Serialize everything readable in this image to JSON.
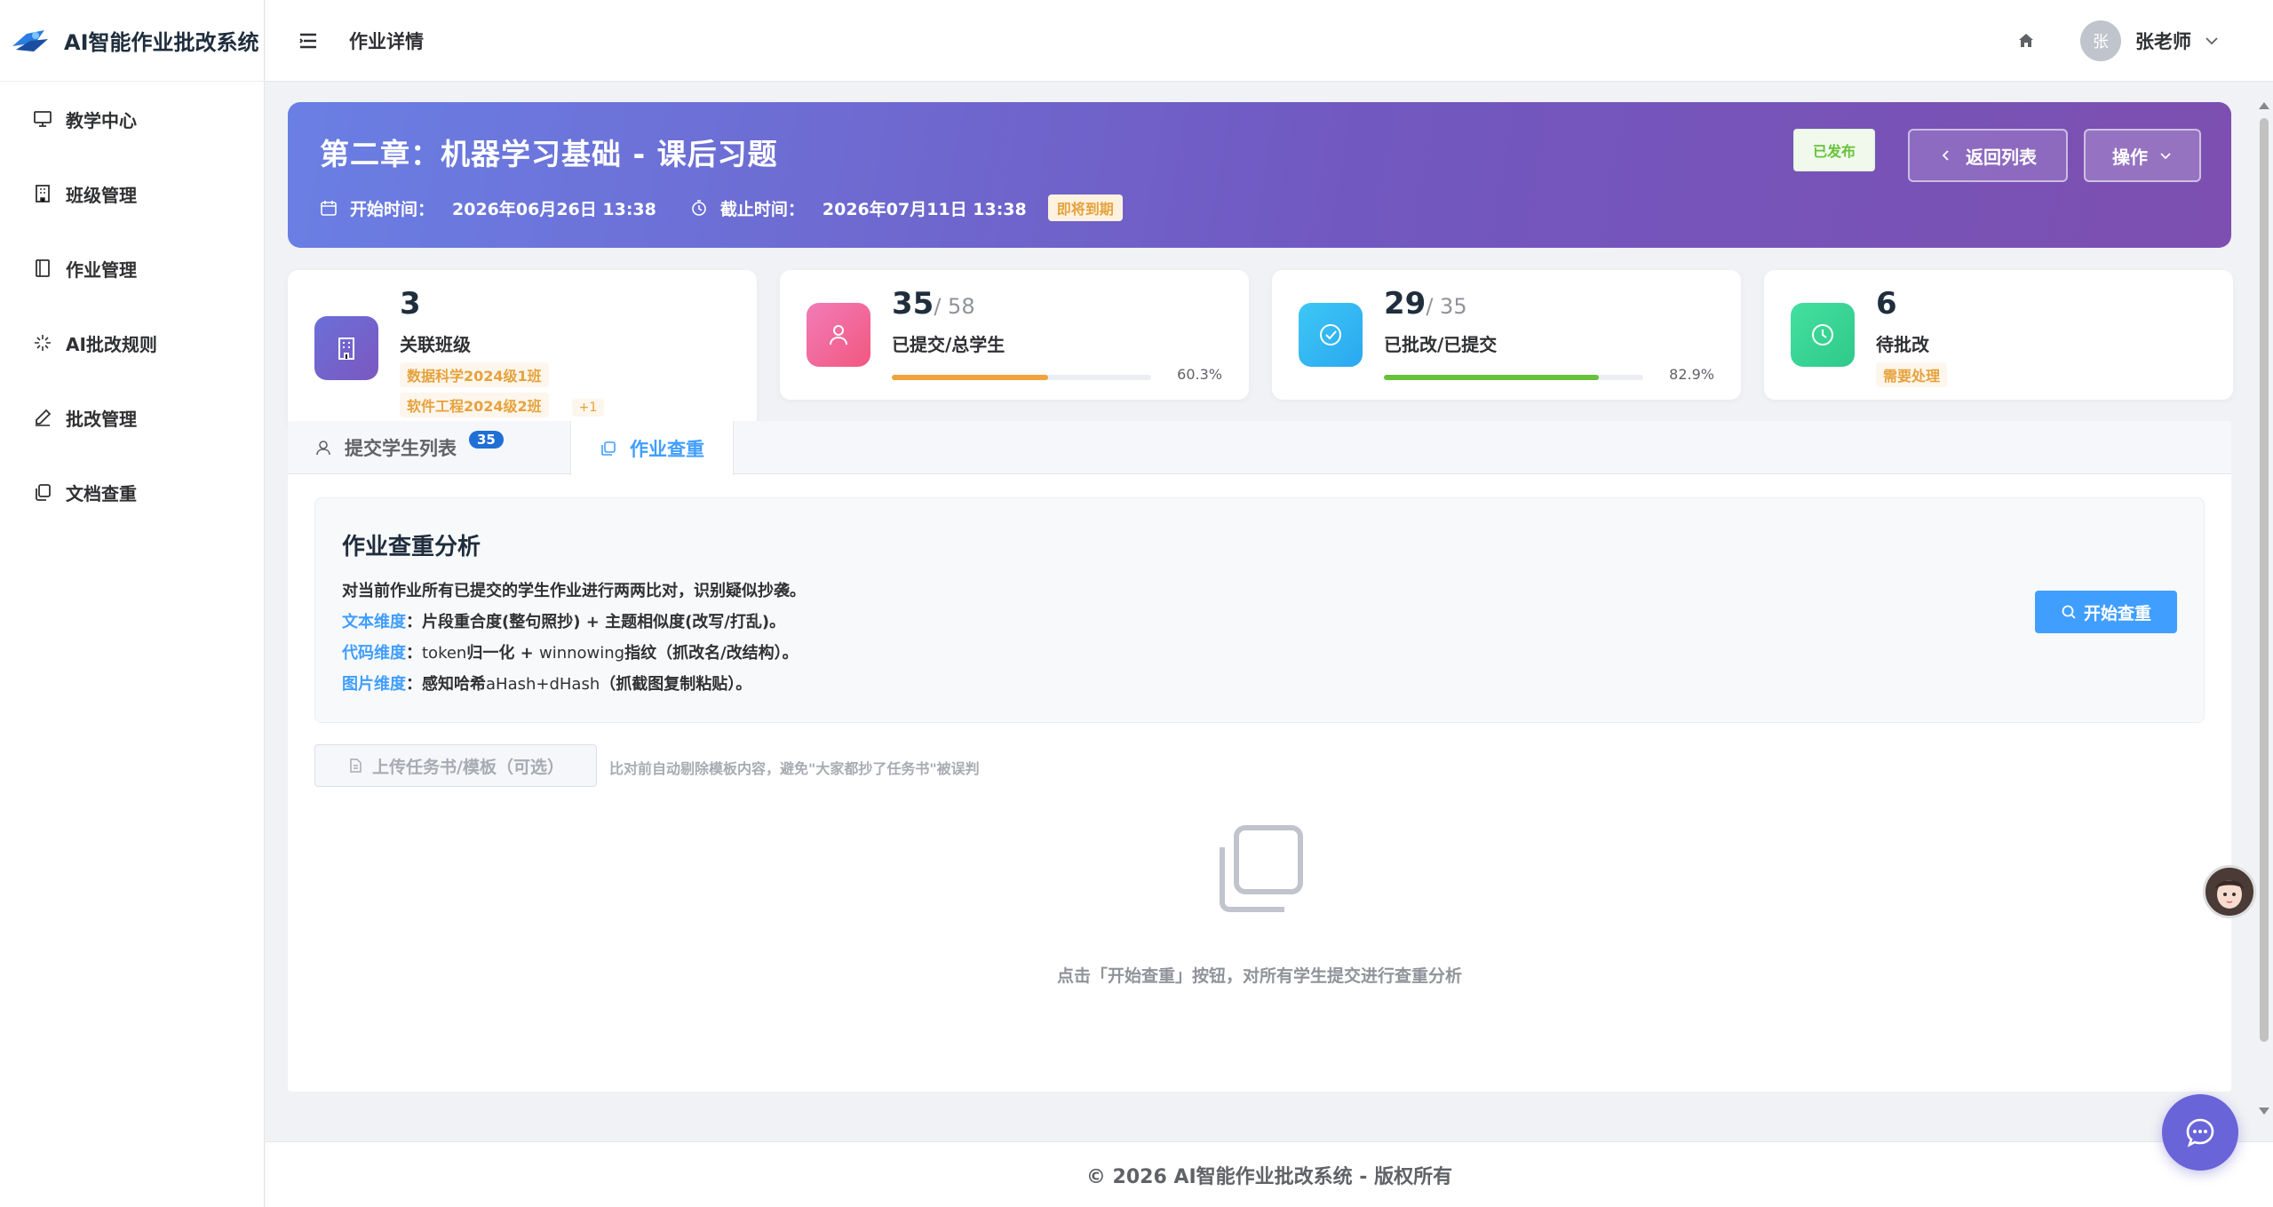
{
  "app": {
    "title": "AI智能作业批改系统"
  },
  "sidebar": {
    "items": [
      {
        "label": "教学中心",
        "icon": "monitor-icon"
      },
      {
        "label": "班级管理",
        "icon": "building-icon"
      },
      {
        "label": "作业管理",
        "icon": "notebook-icon"
      },
      {
        "label": "AI批改规则",
        "icon": "sparkle-icon"
      },
      {
        "label": "批改管理",
        "icon": "pen-icon"
      },
      {
        "label": "文档查重",
        "icon": "copy-icon"
      }
    ]
  },
  "header": {
    "title": "作业详情",
    "user_avatar": "张",
    "user_name": "张老师"
  },
  "hero": {
    "title": "第二章：机器学习基础 - 课后习题",
    "start_label": "开始时间：",
    "start_value": "2026年06月26日 13:38",
    "end_label": "截止时间：",
    "end_value": "2026年07月11日 13:38",
    "deadline_badge": "即将到期",
    "status_badge": "已发布",
    "back_button": "返回列表",
    "op_button": "操作"
  },
  "stats": {
    "classes": {
      "value": "3",
      "label": "关联班级",
      "tags": [
        "数据科学2024级1班",
        "软件工程2024级2班"
      ],
      "more": "+1"
    },
    "submitted": {
      "value": "35",
      "total": "/ 58",
      "label": "已提交/总学生",
      "percent_text": "60.3%",
      "progress": 0.603,
      "color": "#f0a33a"
    },
    "graded": {
      "value": "29",
      "total": "/ 35",
      "label": "已批改/已提交",
      "percent_text": "82.9%",
      "progress": 0.829,
      "color": "#67c23a"
    },
    "pending": {
      "value": "6",
      "label": "待批改",
      "tag": "需要处理"
    }
  },
  "tabs": {
    "students": {
      "label": "提交学生列表",
      "count": "35"
    },
    "plagiarism": {
      "label": "作业查重"
    }
  },
  "analysis": {
    "title": "作业查重分析",
    "intro": "对当前作业所有已提交的学生作业进行两两比对，识别疑似抄袭。",
    "lines": [
      {
        "key": "文本维度",
        "sep": "：",
        "parts": [
          {
            "t": "片段重合度(整句照抄) + 主题相似度(改写/打乱)。",
            "b": true
          }
        ]
      },
      {
        "key": "代码维度",
        "sep": "：",
        "parts": [
          {
            "t": "token",
            "b": false
          },
          {
            "t": "归一化 + ",
            "b": true
          },
          {
            "t": "winnowing",
            "b": false
          },
          {
            "t": "指纹（抓改名/改结构）。",
            "b": true
          }
        ]
      },
      {
        "key": "图片维度",
        "sep": "：",
        "parts": [
          {
            "t": "感知哈希",
            "b": true
          },
          {
            "t": "aHash+dHash",
            "b": false
          },
          {
            "t": "（抓截图复制粘贴）。",
            "b": true
          }
        ]
      }
    ],
    "start_button": "开始查重"
  },
  "upload": {
    "button": "上传任务书/模板（可选）",
    "hint": "比对前自动剔除模板内容，避免\"大家都抄了任务书\"被误判"
  },
  "empty": {
    "text": "点击「开始查重」按钮，对所有学生提交进行查重分析"
  },
  "footer": {
    "text": "© 2026 AI智能作业批改系统 - 版权所有"
  }
}
